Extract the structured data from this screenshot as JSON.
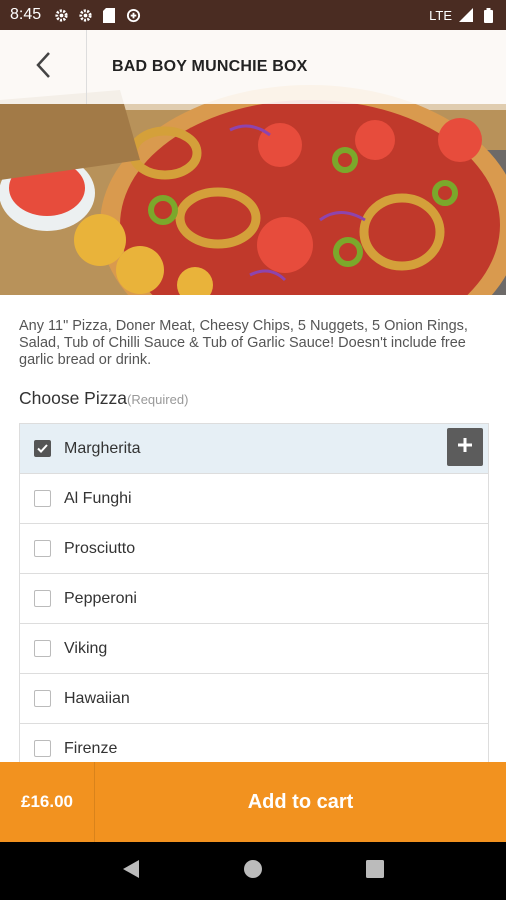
{
  "status_bar": {
    "time": "8:45",
    "network": "LTE"
  },
  "header": {
    "title": "BAD BOY MUNCHIE BOX"
  },
  "product": {
    "description": "Any 11\" Pizza, Doner Meat, Cheesy Chips, 5 Nuggets, 5 Onion Rings, Salad, Tub of Chilli Sauce & Tub of Garlic Sauce! Doesn't include free garlic bread or drink."
  },
  "choose": {
    "title": "Choose Pizza",
    "required": "(Required)"
  },
  "options": [
    {
      "label": "Margherita",
      "checked": true
    },
    {
      "label": "Al Funghi",
      "checked": false
    },
    {
      "label": "Prosciutto",
      "checked": false
    },
    {
      "label": "Pepperoni",
      "checked": false
    },
    {
      "label": "Viking",
      "checked": false
    },
    {
      "label": "Hawaiian",
      "checked": false
    },
    {
      "label": "Firenze",
      "checked": false
    }
  ],
  "cart": {
    "price": "£16.00",
    "add_label": "Add to cart"
  },
  "colors": {
    "accent": "#f2921f",
    "status_bar": "#4a2c22",
    "selected_row": "#e6eff5"
  }
}
